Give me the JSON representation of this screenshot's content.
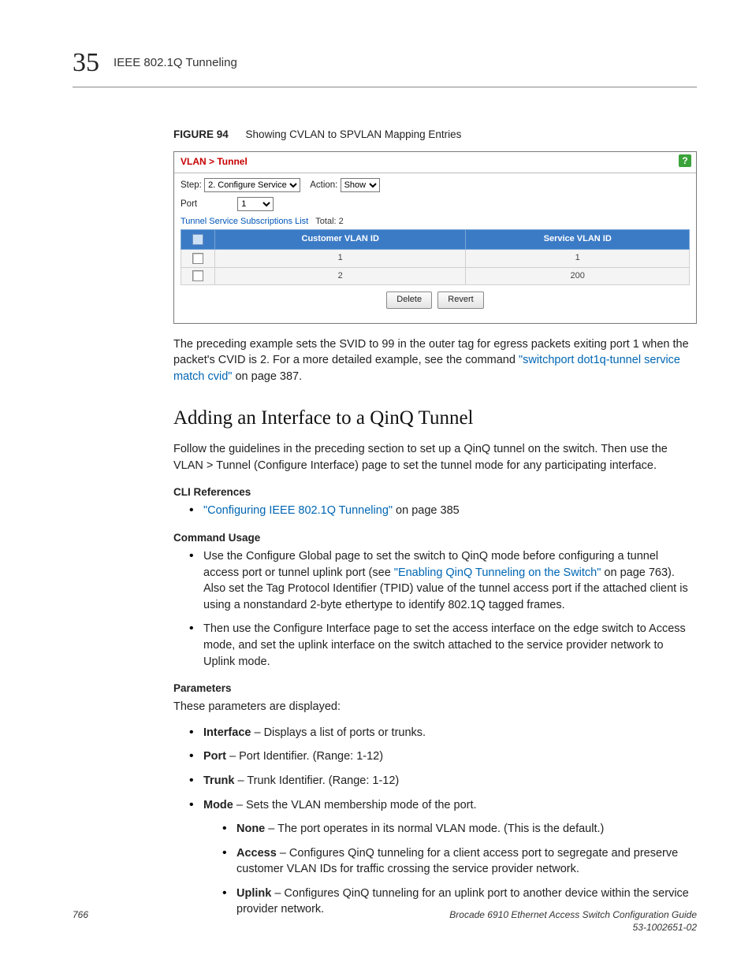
{
  "header": {
    "chapter": "35",
    "title": "IEEE 802.1Q Tunneling"
  },
  "figure": {
    "label": "FIGURE 94",
    "caption": "Showing CVLAN to SPVLAN Mapping Entries"
  },
  "shot": {
    "breadcrumb": "VLAN > Tunnel",
    "help": "?",
    "step_label": "Step:",
    "step_value": "2. Configure Service",
    "action_label": "Action:",
    "action_value": "Show",
    "port_label": "Port",
    "port_value": "1",
    "list_label": "Tunnel Service Subscriptions List",
    "total_label": "Total: 2",
    "col_cvid": "Customer VLAN ID",
    "col_svid": "Service VLAN ID",
    "rows": [
      {
        "cvid": "1",
        "svid": "1"
      },
      {
        "cvid": "2",
        "svid": "200"
      }
    ],
    "btn_delete": "Delete",
    "btn_revert": "Revert"
  },
  "para1_a": "The preceding example sets the SVID to 99 in the outer tag for egress packets exiting port 1 when the packet's CVID is 2. For a more detailed example, see the command ",
  "para1_link": "\"switchport dot1q-tunnel service match cvid\"",
  "para1_b": " on page 387.",
  "sec_heading": "Adding an Interface to a QinQ Tunnel",
  "sec_intro": "Follow the guidelines in the preceding section to set up a QinQ tunnel on the switch. Then use the VLAN > Tunnel (Configure Interface) page to set the tunnel mode for any participating interface.",
  "cli_ref_h": "CLI References",
  "cli_ref_link": "\"Configuring IEEE 802.1Q Tunneling\"",
  "cli_ref_tail": " on page 385",
  "cmd_usage_h": "Command Usage",
  "cmd1_a": "Use the Configure Global page to set the switch to QinQ mode before configuring a tunnel access port or tunnel uplink port (see ",
  "cmd1_link": "\"Enabling QinQ Tunneling on the Switch\"",
  "cmd1_b": " on page 763). Also set the Tag Protocol Identifier (TPID) value of the tunnel access port if the attached client is using a nonstandard 2-byte ethertype to identify 802.1Q tagged frames.",
  "cmd2": "Then use the Configure Interface page to set the access interface on the edge switch to Access mode, and set the uplink interface on the switch attached to the service provider network to Uplink mode.",
  "params_h": "Parameters",
  "params_intro": "These parameters are displayed:",
  "p_interface_b": "Interface",
  "p_interface_t": " – Displays a list of ports or trunks.",
  "p_port_b": "Port",
  "p_port_t": " – Port Identifier. (Range: 1-12)",
  "p_trunk_b": "Trunk",
  "p_trunk_t": " – Trunk Identifier. (Range: 1-12)",
  "p_mode_b": "Mode",
  "p_mode_t": " – Sets the VLAN membership mode of the port.",
  "p_none_b": "None",
  "p_none_t": " – The port operates in its normal VLAN mode. (This is the default.)",
  "p_access_b": "Access",
  "p_access_t": " – Configures QinQ tunneling for a client access port to segregate and preserve customer VLAN IDs for traffic crossing the service provider network.",
  "p_uplink_b": "Uplink",
  "p_uplink_t": " – Configures QinQ tunneling for an uplink port to another device within the service provider network.",
  "footer": {
    "page": "766",
    "doc1": "Brocade 6910 Ethernet Access Switch Configuration Guide",
    "doc2": "53-1002651-02"
  }
}
